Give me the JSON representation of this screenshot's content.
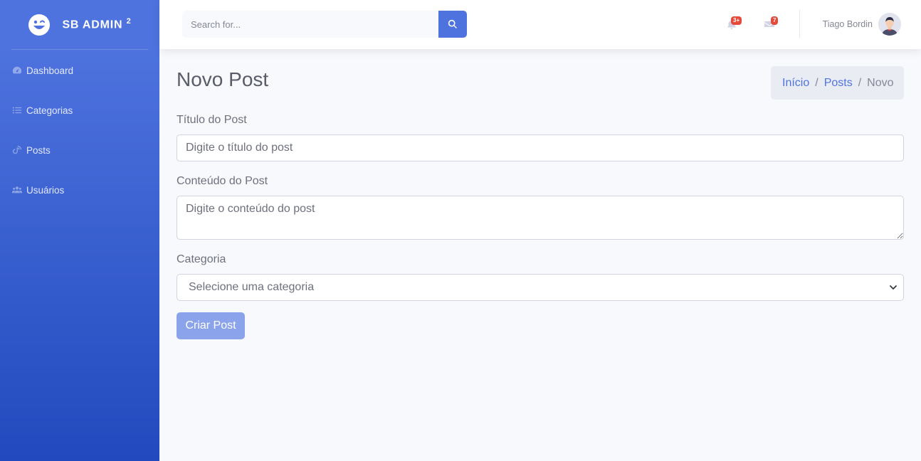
{
  "brand": {
    "name": "SB ADMIN",
    "superscript": "2"
  },
  "sidebar": {
    "items": [
      {
        "label": "Dashboard",
        "icon": "tachometer-icon"
      },
      {
        "label": "Categorias",
        "icon": "list-icon"
      },
      {
        "label": "Posts",
        "icon": "blog-icon"
      },
      {
        "label": "Usuários",
        "icon": "users-icon"
      }
    ]
  },
  "topbar": {
    "search_placeholder": "Search for...",
    "alerts_badge": "3+",
    "messages_badge": "7",
    "user_name": "Tiago Bordin"
  },
  "page": {
    "title": "Novo Post",
    "breadcrumb": {
      "home": "Início",
      "section": "Posts",
      "current": "Novo",
      "separator": "/"
    }
  },
  "form": {
    "title_label": "Título do Post",
    "title_placeholder": "Digite o título do post",
    "content_label": "Conteúdo do Post",
    "content_placeholder": "Digite o conteúdo do post",
    "category_label": "Categoria",
    "category_selected": "Selecione uma categoria",
    "submit_label": "Criar Post"
  },
  "colors": {
    "primary": "#4e73df",
    "primary_dark": "#224abe",
    "danger": "#e74a3b",
    "background": "#f8f9fc"
  }
}
